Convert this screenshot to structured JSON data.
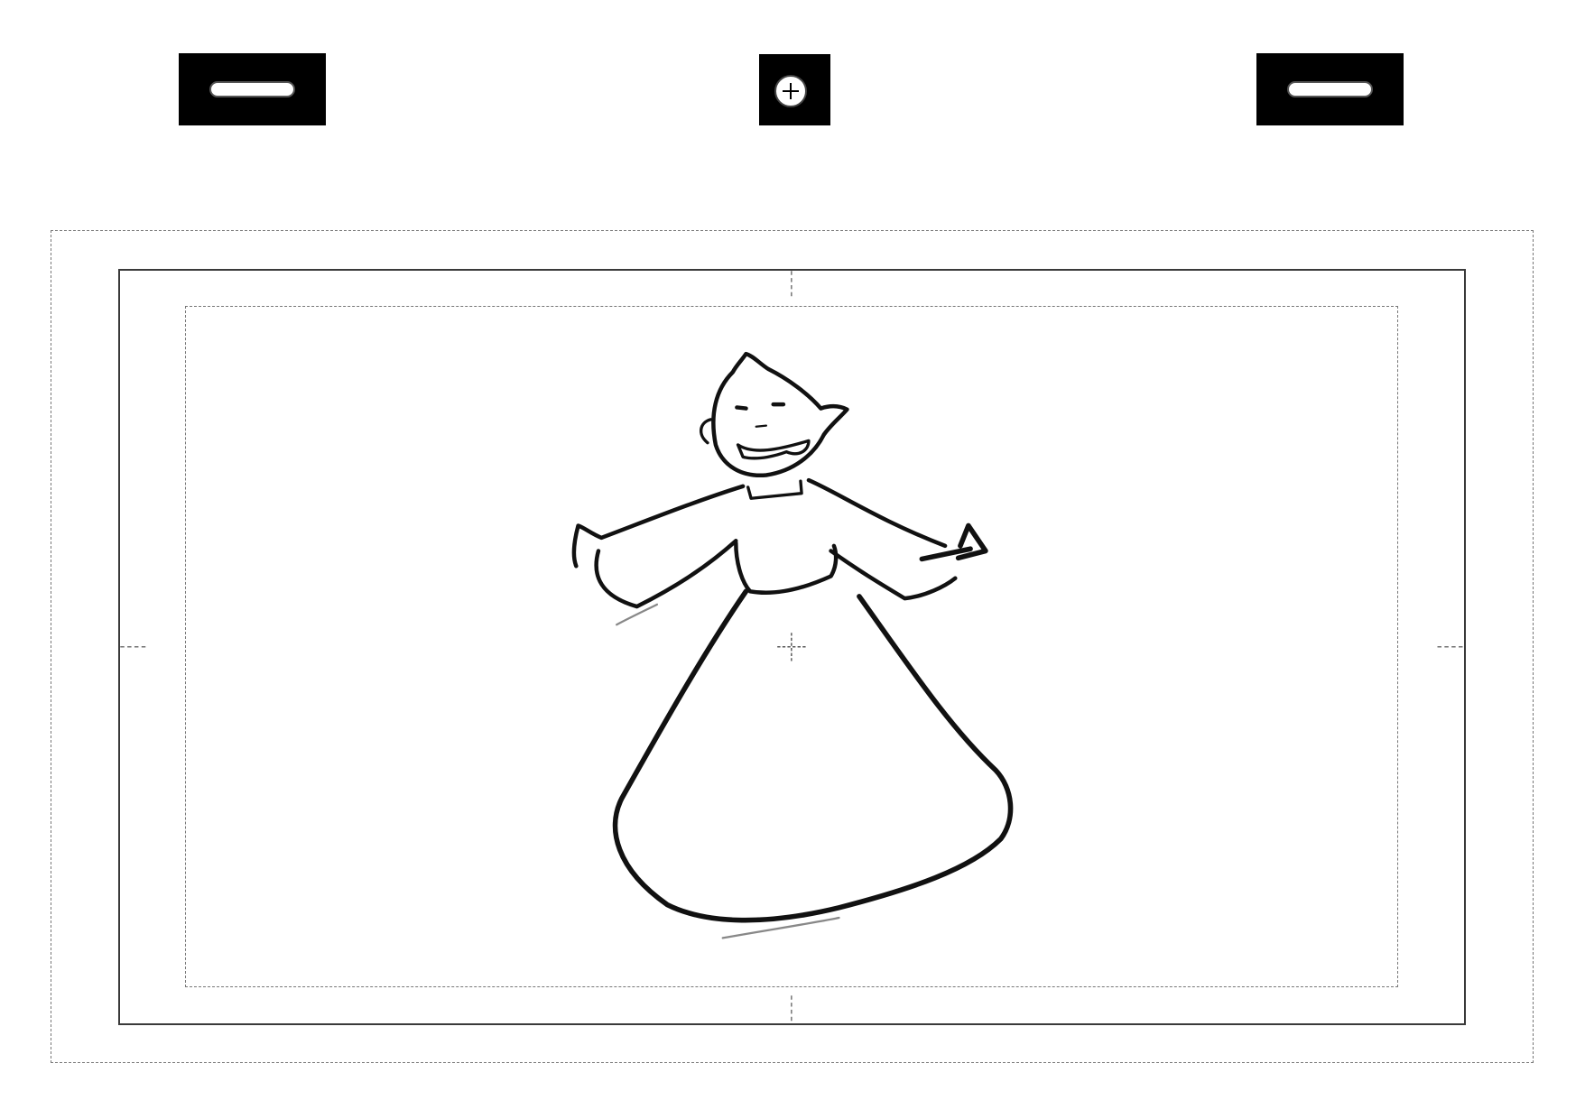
{
  "sheet": {
    "peg_holes": [
      {
        "shape": "slot",
        "position": "left"
      },
      {
        "shape": "round",
        "position": "center"
      },
      {
        "shape": "slot",
        "position": "right"
      }
    ],
    "icons": [
      "registration-cross-icon"
    ],
    "colors": {
      "peg_bar": "#000000",
      "frame": "#3a3a3a",
      "guide": "#777777",
      "sketch": "#111111"
    }
  }
}
